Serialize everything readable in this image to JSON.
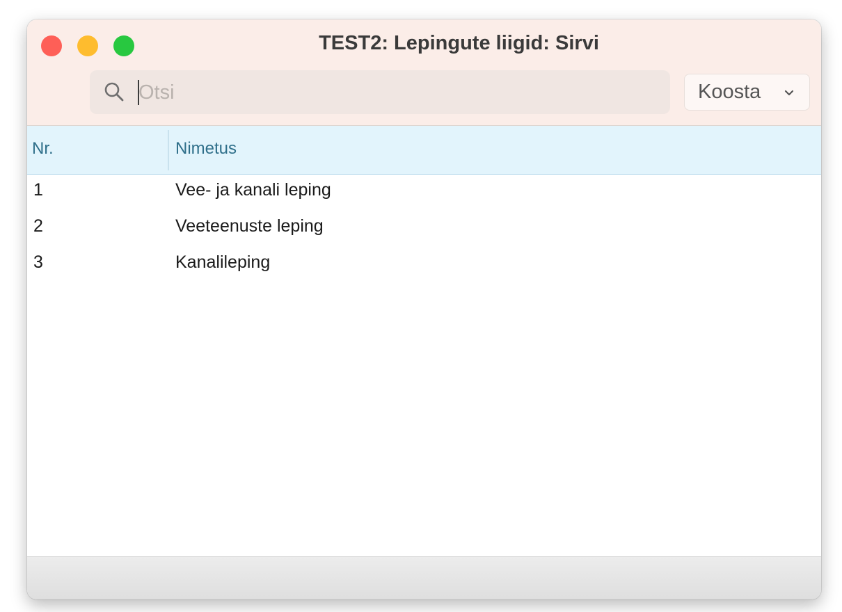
{
  "window": {
    "title": "TEST2: Lepingute liigid: Sirvi"
  },
  "colors": {
    "titlebar_bg": "#fbede8",
    "header_bg": "#e2f4fc",
    "traffic_close": "#fe5f57",
    "traffic_minimize": "#febc2e",
    "traffic_zoom": "#28c840"
  },
  "toolbar": {
    "search_placeholder": "Otsi",
    "search_value": "",
    "koosta_label": "Koosta",
    "search_icon": "search-icon",
    "dropdown_icon": "chevron-down-icon"
  },
  "table": {
    "columns": [
      "Nr.",
      "Nimetus"
    ],
    "rows": [
      {
        "nr": "1",
        "name": "Vee- ja kanali leping"
      },
      {
        "nr": "2",
        "name": "Veeteenuste leping"
      },
      {
        "nr": "3",
        "name": "Kanalileping"
      }
    ]
  }
}
